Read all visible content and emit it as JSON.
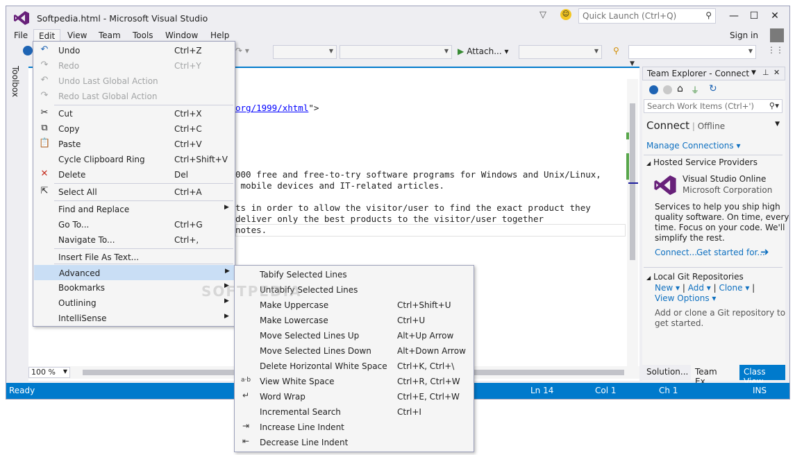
{
  "window": {
    "title": "Softpedia.html - Microsoft Visual Studio",
    "quick_launch_placeholder": "Quick Launch (Ctrl+Q)",
    "signin": "Sign in"
  },
  "menubar": [
    "File",
    "Edit",
    "View",
    "Team",
    "Tools",
    "Window",
    "Help"
  ],
  "toolbar": {
    "attach_label": "Attach..."
  },
  "toolbox_label": "Toolbox",
  "editor": {
    "lines": [
      {
        "text": "org/1999/xhtml",
        "suffix": "\">"
      },
      {
        "text": "000 free and free-to-try software programs for Windows and Unix/Linux,"
      },
      {
        "text": " mobile devices and IT-related articles."
      },
      {
        "text": "ts in order to allow the visitor/user to find the exact product they"
      },
      {
        "text": "deliver only the best products to the visitor/user together"
      },
      {
        "text": "notes."
      }
    ],
    "zoom": "100 %"
  },
  "edit_menu": [
    {
      "label": "Undo",
      "shortcut": "Ctrl+Z",
      "icon": "undo-icon",
      "disabled": false
    },
    {
      "label": "Redo",
      "shortcut": "Ctrl+Y",
      "icon": "redo-icon",
      "disabled": true
    },
    {
      "label": "Undo Last Global Action",
      "shortcut": "",
      "icon": "undo-global-icon",
      "disabled": true
    },
    {
      "label": "Redo Last Global Action",
      "shortcut": "",
      "icon": "redo-global-icon",
      "disabled": true
    },
    {
      "label": "Cut",
      "shortcut": "Ctrl+X",
      "icon": "cut-icon"
    },
    {
      "label": "Copy",
      "shortcut": "Ctrl+C",
      "icon": "copy-icon"
    },
    {
      "label": "Paste",
      "shortcut": "Ctrl+V",
      "icon": "paste-icon"
    },
    {
      "label": "Cycle Clipboard Ring",
      "shortcut": "Ctrl+Shift+V"
    },
    {
      "label": "Delete",
      "shortcut": "Del",
      "icon": "delete-icon"
    },
    {
      "label": "Select All",
      "shortcut": "Ctrl+A",
      "icon": "select-all-icon"
    },
    {
      "label": "Find and Replace",
      "shortcut": "",
      "submenu": true
    },
    {
      "label": "Go To...",
      "shortcut": "Ctrl+G"
    },
    {
      "label": "Navigate To...",
      "shortcut": "Ctrl+,"
    },
    {
      "label": "Insert File As Text..."
    },
    {
      "label": "Advanced",
      "submenu": true,
      "highlighted": true
    },
    {
      "label": "Bookmarks",
      "submenu": true
    },
    {
      "label": "Outlining",
      "submenu": true
    },
    {
      "label": "IntelliSense",
      "submenu": true
    }
  ],
  "advanced_menu": [
    {
      "label": "Tabify Selected Lines",
      "shortcut": ""
    },
    {
      "label": "Untabify Selected Lines",
      "shortcut": ""
    },
    {
      "label": "Make Uppercase",
      "shortcut": "Ctrl+Shift+U"
    },
    {
      "label": "Make Lowercase",
      "shortcut": "Ctrl+U"
    },
    {
      "label": "Move Selected Lines Up",
      "shortcut": "Alt+Up Arrow"
    },
    {
      "label": "Move Selected Lines Down",
      "shortcut": "Alt+Down Arrow"
    },
    {
      "label": "Delete Horizontal White Space",
      "shortcut": "Ctrl+K, Ctrl+\\"
    },
    {
      "label": "View White Space",
      "shortcut": "Ctrl+R, Ctrl+W",
      "icon": "a·b"
    },
    {
      "label": "Word Wrap",
      "shortcut": "Ctrl+E, Ctrl+W",
      "icon": "↵"
    },
    {
      "label": "Incremental Search",
      "shortcut": "Ctrl+I"
    },
    {
      "label": "Increase Line Indent",
      "shortcut": "",
      "icon": "⇥"
    },
    {
      "label": "Decrease Line Indent",
      "shortcut": "",
      "icon": "⇤"
    }
  ],
  "team_explorer": {
    "title": "Team Explorer - Connect",
    "search_placeholder": "Search Work Items (Ctrl+')",
    "connect": "Connect",
    "offline": "Offline",
    "manage_connections": "Manage Connections",
    "hosted_header": "Hosted Service Providers",
    "vso_name": "Visual Studio Online",
    "vso_corp": "Microsoft Corporation",
    "vso_desc": [
      "Services to help you ship high",
      "quality software. On time, every",
      "time. Focus on your code. We'll",
      "simplify the rest."
    ],
    "connect_link": "Connect...",
    "get_started_link": "Get started for...",
    "git_header": "Local Git Repositories",
    "new_link": "New",
    "add_link": "Add",
    "clone_link": "Clone",
    "view_options": "View Options",
    "git_desc": [
      "Add or clone a Git repository to",
      "get started."
    ],
    "tabs": [
      "Solution...",
      "Team Ex...",
      "Class View"
    ]
  },
  "statusbar": {
    "ready": "Ready",
    "ln": "Ln 14",
    "col": "Col 1",
    "ch": "Ch 1",
    "ins": "INS"
  },
  "watermark": "SOFTPEDIA",
  "colors": {
    "accent": "#007acc",
    "menu_highlight": "#c9def5",
    "link": "#0e70c0",
    "vs_purple": "#68217a"
  }
}
